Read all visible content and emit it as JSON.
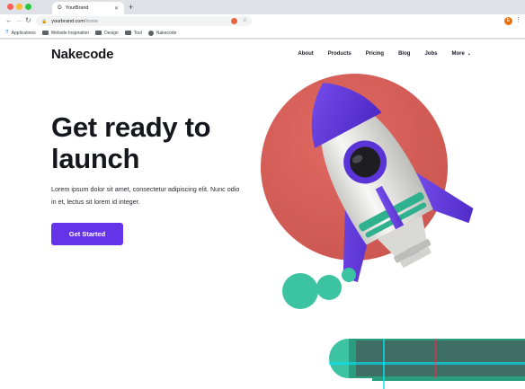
{
  "browser": {
    "tab_title": "YourBrand",
    "tab_favicon": "G",
    "new_tab_label": "+",
    "url_host": "yourbrand.com",
    "url_path": "/home",
    "profile_initial": "E",
    "bookmarks": [
      {
        "label": "Applications",
        "icon": "apps-icon"
      },
      {
        "label": "Website Inspiration",
        "icon": "folder-icon"
      },
      {
        "label": "Design",
        "icon": "folder-icon"
      },
      {
        "label": "Tool",
        "icon": "folder-icon"
      },
      {
        "label": "Nakecode",
        "icon": "globe-icon"
      }
    ]
  },
  "site": {
    "logo": "Nakecode",
    "menu": [
      "About",
      "Products",
      "Pricing",
      "Blog",
      "Jobs",
      "More"
    ]
  },
  "hero": {
    "title": "Get ready to launch",
    "text": "Lorem ipsum dolor sit amet, consectetur adipiscing elit. Nunc odio in et, lectus sit lorem id integer.",
    "cta_label": "Get Started"
  },
  "colors": {
    "accent": "#6534e8",
    "circle": "#d9605a",
    "rocket_purple": "#6a3fe0",
    "rocket_body": "#ececea",
    "flame": "#3cc4a2"
  }
}
